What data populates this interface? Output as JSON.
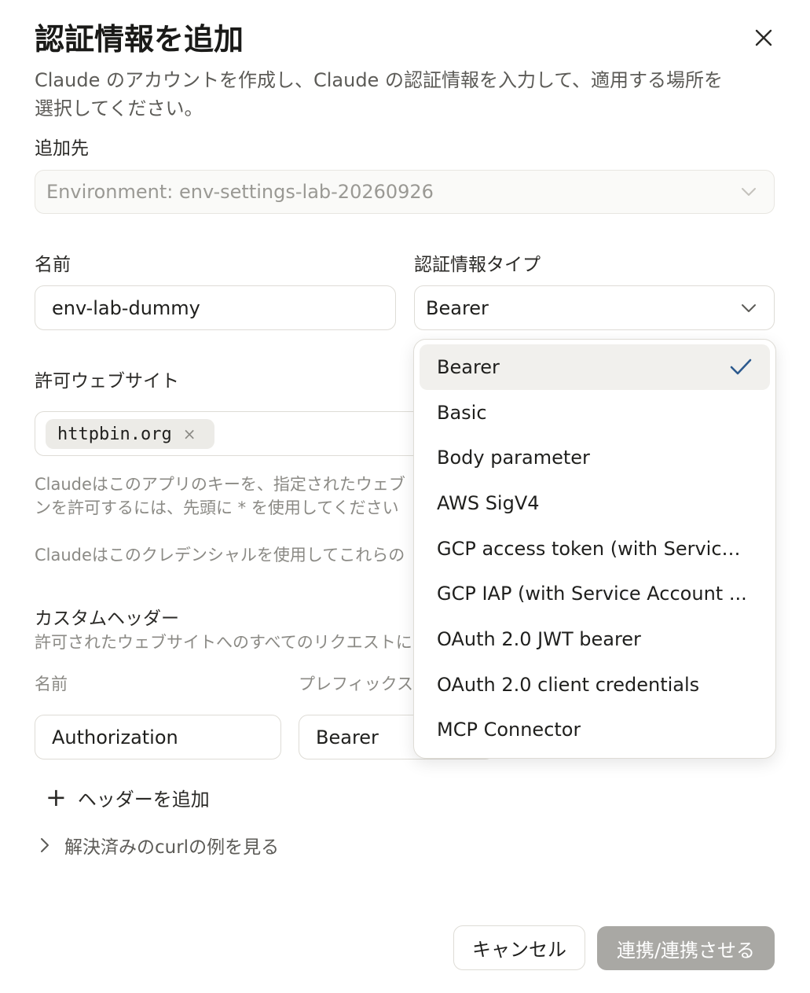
{
  "dialog": {
    "title": "認証情報を追加",
    "description": "Claude のアカウントを作成し、Claude の認証情報を入力して、適用する場所を選択してください。"
  },
  "destination": {
    "label": "追加先",
    "value": "Environment: env-settings-lab-20260926"
  },
  "name": {
    "label": "名前",
    "value": "env-lab-dummy"
  },
  "credential_type": {
    "label": "認証情報タイプ",
    "value": "Bearer",
    "options": [
      "Bearer",
      "Basic",
      "Body parameter",
      "AWS SigV4",
      "GCP access token (with Service...",
      "GCP IAP (with Service Account ...",
      "OAuth 2.0 JWT bearer",
      "OAuth 2.0 client credentials",
      "MCP Connector"
    ],
    "selected_index": 0
  },
  "allowed_sites": {
    "label": "許可ウェブサイト",
    "chips": [
      "httpbin.org"
    ],
    "help_line1": "Claudeはこのアプリのキーを、指定されたウェブ",
    "help_line2": "ンを許可するには、先頭に * を使用してください",
    "help_line3": "Claudeはこのクレデンシャルを使用してこれらの"
  },
  "custom_headers": {
    "label": "カスタムヘッダー",
    "description": "許可されたウェブサイトへのすべてのリクエストに",
    "col_name": "名前",
    "col_prefix": "プレフィックス",
    "row": {
      "name": "Authorization",
      "prefix": "Bearer"
    },
    "add_label": "ヘッダーを追加"
  },
  "curl_example": {
    "label": "解決済みのcurlの例を見る"
  },
  "footer": {
    "cancel_label": "キャンセル",
    "submit_label": "連携/連携させる"
  },
  "colors": {
    "text": "#1f1f1d",
    "muted": "#8b8a85",
    "border": "#dedcd6",
    "disabled_button": "#a9a8a4",
    "selected_option_bg": "#f1f0ed",
    "check": "#2d5a8e"
  }
}
